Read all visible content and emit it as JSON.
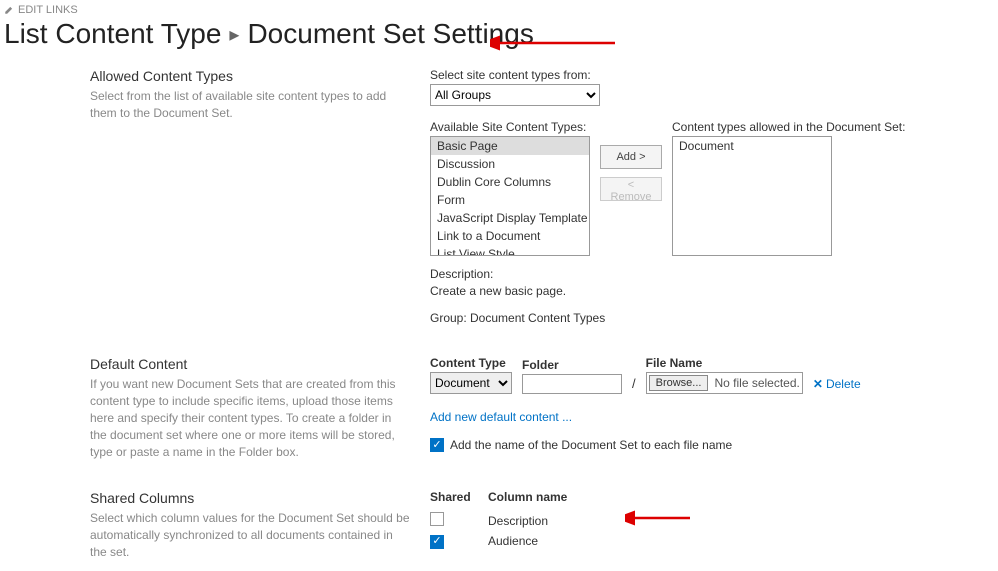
{
  "editLinks": "EDIT LINKS",
  "breadcrumb": {
    "parent": "List Content Type",
    "current": "Document Set Settings"
  },
  "allowedTypes": {
    "heading": "Allowed Content Types",
    "desc": "Select from the list of available site content types to add them to the Document Set.",
    "selectFromLabel": "Select site content types from:",
    "groupSelected": "All Groups",
    "availableLabel": "Available Site Content Types:",
    "available": [
      "Basic Page",
      "Discussion",
      "Dublin Core Columns",
      "Form",
      "JavaScript Display Template",
      "Link to a Document",
      "List View Style"
    ],
    "allowedLabel": "Content types allowed in the Document Set:",
    "allowed": [
      "Document"
    ],
    "addBtn": "Add >",
    "removeBtn": "< Remove",
    "descriptionLabel": "Description:",
    "descriptionText": "Create a new basic page.",
    "groupLine": "Group: Document Content Types"
  },
  "defaultContent": {
    "heading": "Default Content",
    "desc": "If you want new Document Sets that are created from this content type to include specific items, upload those items here and specify their content types. To create a folder in the document set where one or more items will be stored, type or paste a name in the Folder box.",
    "contentTypeLabel": "Content Type",
    "contentTypeSelected": "Document",
    "folderLabel": "Folder",
    "folderValue": "",
    "fileNameLabel": "File Name",
    "browse": "Browse...",
    "noFile": "No file selected.",
    "deleteLabel": "Delete",
    "addNewLink": "Add new default content ...",
    "addNameChkLabel": "Add the name of the Document Set to each file name",
    "addNameChecked": true
  },
  "sharedColumns": {
    "heading": "Shared Columns",
    "desc": "Select which column values for the Document Set should be automatically synchronized to all documents contained in the set.",
    "colShared": "Shared",
    "colName": "Column name",
    "rows": [
      {
        "checked": false,
        "name": "Description"
      },
      {
        "checked": true,
        "name": "Audience"
      }
    ]
  }
}
